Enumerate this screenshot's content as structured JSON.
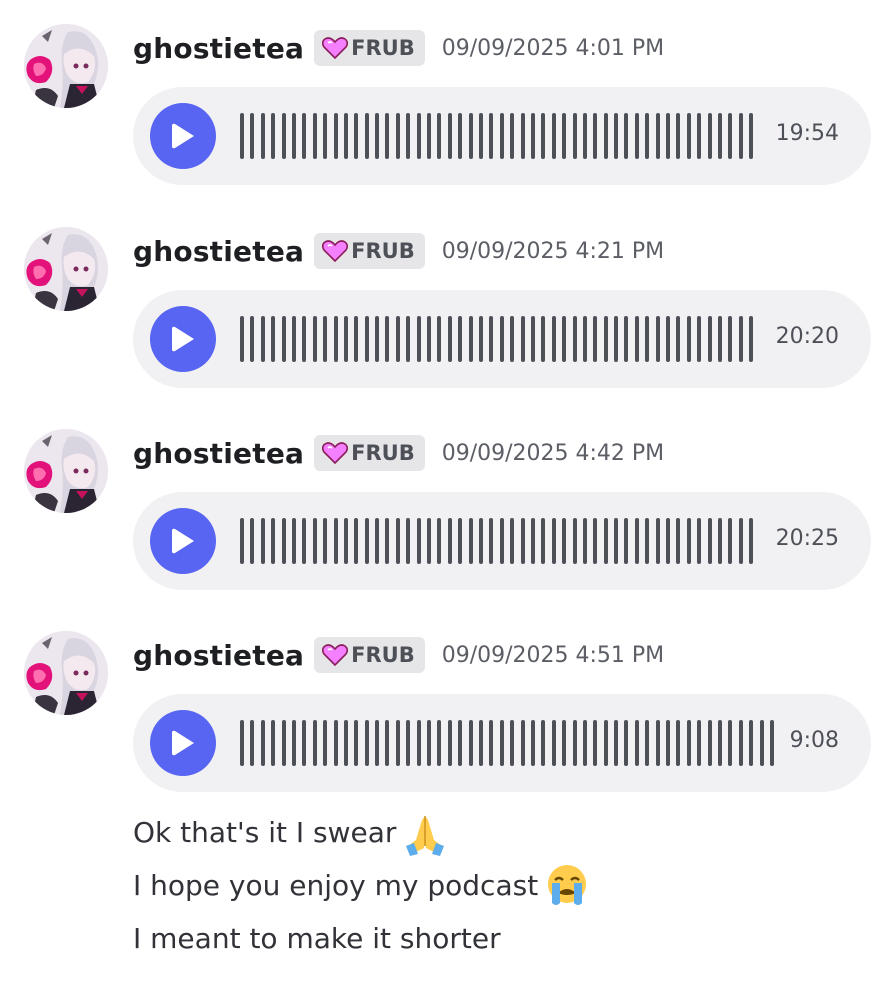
{
  "messages": [
    {
      "username": "ghostietea",
      "tag": "FRUB",
      "timestamp": "09/09/2025 4:01 PM",
      "duration": "19:54"
    },
    {
      "username": "ghostietea",
      "tag": "FRUB",
      "timestamp": "09/09/2025 4:21 PM",
      "duration": "20:20"
    },
    {
      "username": "ghostietea",
      "tag": "FRUB",
      "timestamp": "09/09/2025 4:42 PM",
      "duration": "20:25"
    },
    {
      "username": "ghostietea",
      "tag": "FRUB",
      "timestamp": "09/09/2025 4:51 PM",
      "duration": "9:08"
    }
  ],
  "text_lines": [
    {
      "text": "Ok that's it I swear",
      "emoji": "folded-hands"
    },
    {
      "text": "I hope you enjoy my podcast",
      "emoji": "loudly-crying-face"
    },
    {
      "text": "I meant to make it shorter",
      "emoji": ""
    }
  ],
  "colors": {
    "play_button": "#5865f2",
    "voice_bg": "#f1f1f3",
    "tag_bg": "#e6e6e9",
    "heart": "#f47fff"
  },
  "icons": {
    "play": "play-icon",
    "tag": "heart-icon"
  }
}
